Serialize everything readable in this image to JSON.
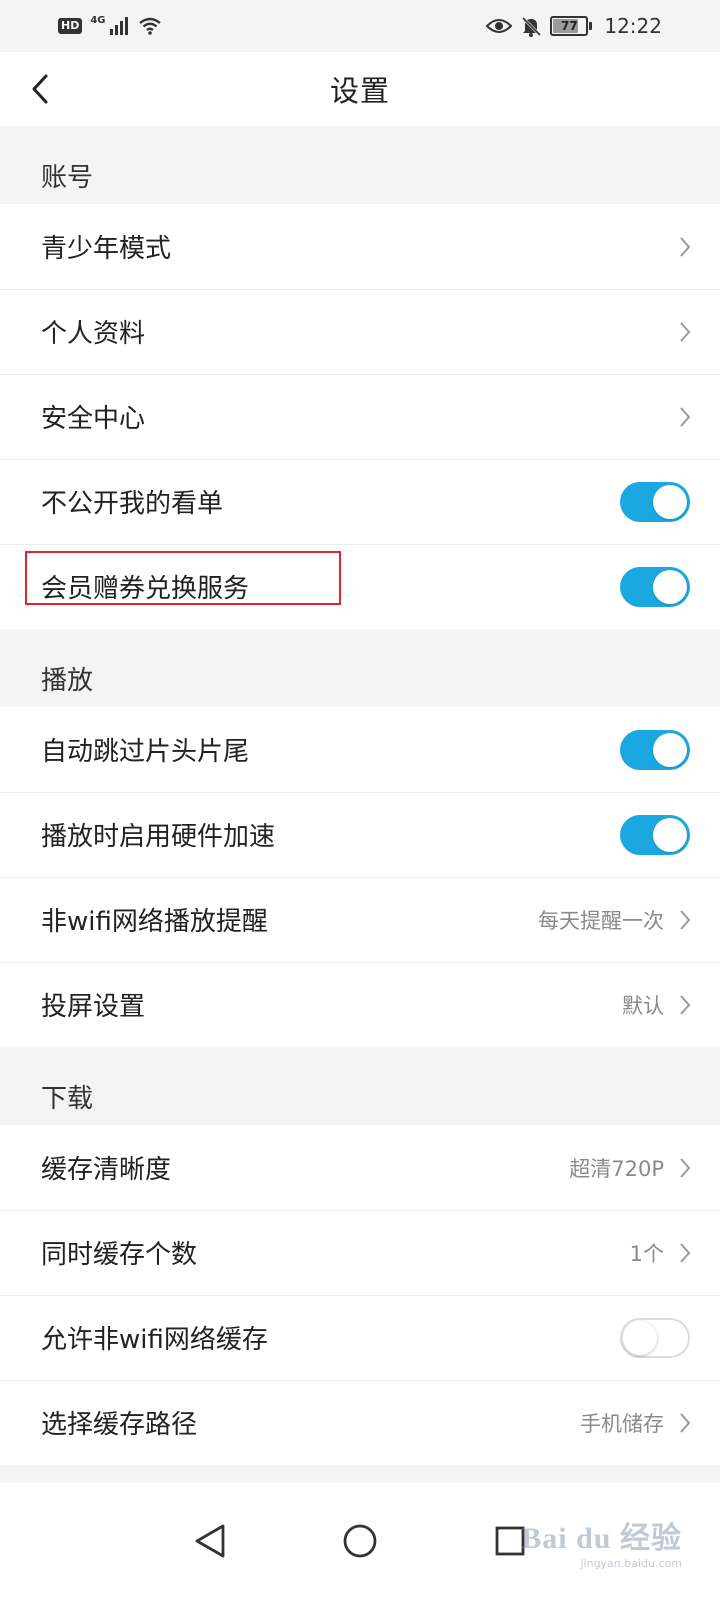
{
  "status_bar": {
    "hd": "HD",
    "network": "4G",
    "battery": "77",
    "battery_level": 0.77,
    "time": "12:22",
    "icons": [
      "signal-icon",
      "wifi-icon",
      "eye-icon",
      "bell-off-icon",
      "battery-icon"
    ]
  },
  "header": {
    "title": "设置",
    "back_icon": "chevron-left-icon"
  },
  "sections": {
    "account": {
      "title": "账号",
      "items": [
        {
          "label": "青少年模式",
          "type": "link"
        },
        {
          "label": "个人资料",
          "type": "link"
        },
        {
          "label": "安全中心",
          "type": "link"
        },
        {
          "label": "不公开我的看单",
          "type": "toggle",
          "on": true
        },
        {
          "label": "会员赠券兑换服务",
          "type": "toggle",
          "on": true
        }
      ]
    },
    "playback": {
      "title": "播放",
      "items": [
        {
          "label": "自动跳过片头片尾",
          "type": "toggle",
          "on": true
        },
        {
          "label": "播放时启用硬件加速",
          "type": "toggle",
          "on": true
        },
        {
          "label": "非wifi网络播放提醒",
          "type": "link",
          "value": "每天提醒一次"
        },
        {
          "label": "投屏设置",
          "type": "link",
          "value": "默认"
        }
      ]
    },
    "download": {
      "title": "下载",
      "items": [
        {
          "label": "缓存清晰度",
          "type": "link",
          "value": "超清720P"
        },
        {
          "label": "同时缓存个数",
          "type": "link",
          "value": "1个"
        },
        {
          "label": "允许非wifi网络缓存",
          "type": "toggle",
          "on": false
        },
        {
          "label": "选择缓存路径",
          "type": "link",
          "value": "手机储存"
        }
      ]
    }
  },
  "bottom_nav": {
    "back": "triangle-back-icon",
    "home": "circle-home-icon",
    "recents": "square-recents-icon"
  },
  "watermark": {
    "main": "Bai du 经验",
    "sub": "jingyan.baidu.com"
  },
  "colors": {
    "accent": "#1ba7e0",
    "highlight": "#e0242d",
    "background": "#f4f4f4"
  }
}
